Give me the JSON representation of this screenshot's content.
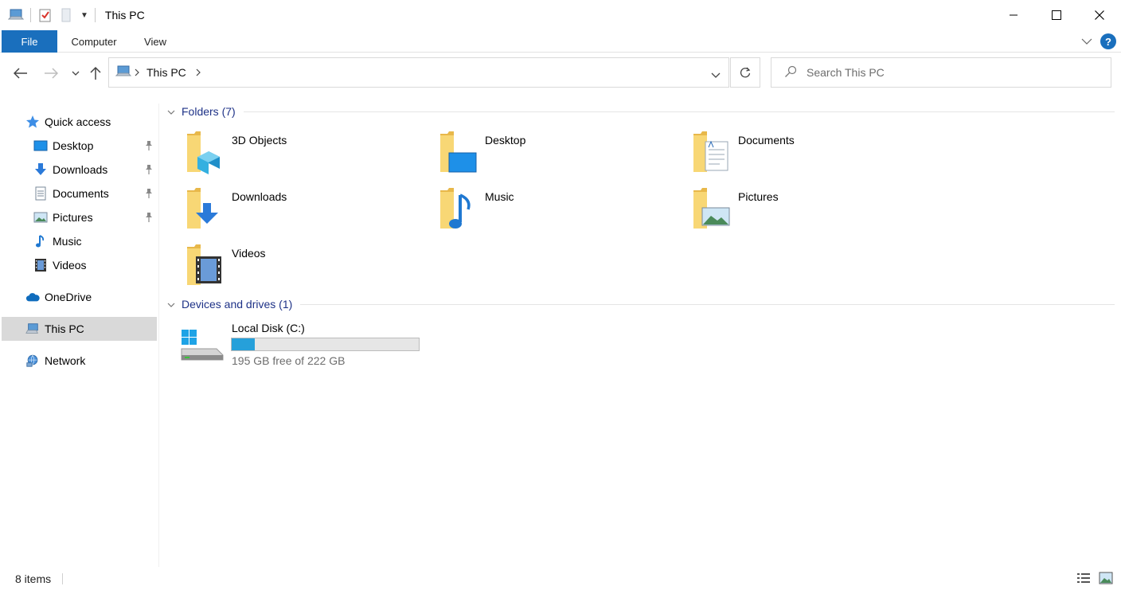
{
  "window": {
    "title": "This PC",
    "controls": [
      "minimize-icon",
      "maximize-icon",
      "close-icon"
    ]
  },
  "quick_access_toolbar": {
    "icons": [
      "computer-icon",
      "properties-icon",
      "new-folder-icon",
      "customize-dropdown-icon"
    ]
  },
  "ribbon": {
    "tabs": [
      {
        "label": "File",
        "active": true
      },
      {
        "label": "Computer"
      },
      {
        "label": "View"
      }
    ],
    "help_label": "?"
  },
  "address": {
    "crumbs": [
      "This PC"
    ],
    "search_placeholder": "Search This PC"
  },
  "sidebar": {
    "quick_access": {
      "label": "Quick access"
    },
    "pinned": [
      {
        "label": "Desktop",
        "pinned": true
      },
      {
        "label": "Downloads",
        "pinned": true
      },
      {
        "label": "Documents",
        "pinned": true
      },
      {
        "label": "Pictures",
        "pinned": true
      },
      {
        "label": "Music",
        "pinned": false
      },
      {
        "label": "Videos",
        "pinned": false
      }
    ],
    "onedrive": {
      "label": "OneDrive"
    },
    "this_pc": {
      "label": "This PC",
      "selected": true
    },
    "network": {
      "label": "Network"
    }
  },
  "main": {
    "folders_header": "Folders (7)",
    "folders": [
      {
        "label": "3D Objects"
      },
      {
        "label": "Desktop"
      },
      {
        "label": "Documents"
      },
      {
        "label": "Downloads"
      },
      {
        "label": "Music"
      },
      {
        "label": "Pictures"
      },
      {
        "label": "Videos"
      }
    ],
    "devices_header": "Devices and drives (1)",
    "drives": [
      {
        "label": "Local Disk (C:)",
        "size_text": "195 GB free of 222 GB",
        "used_fraction": 0.122
      }
    ]
  },
  "status": {
    "item_count": "8 items"
  },
  "colors": {
    "accent": "#1a6fbd",
    "header_text": "#1e3287",
    "drive_fill": "#26a0da",
    "folder": "#f8d775"
  }
}
